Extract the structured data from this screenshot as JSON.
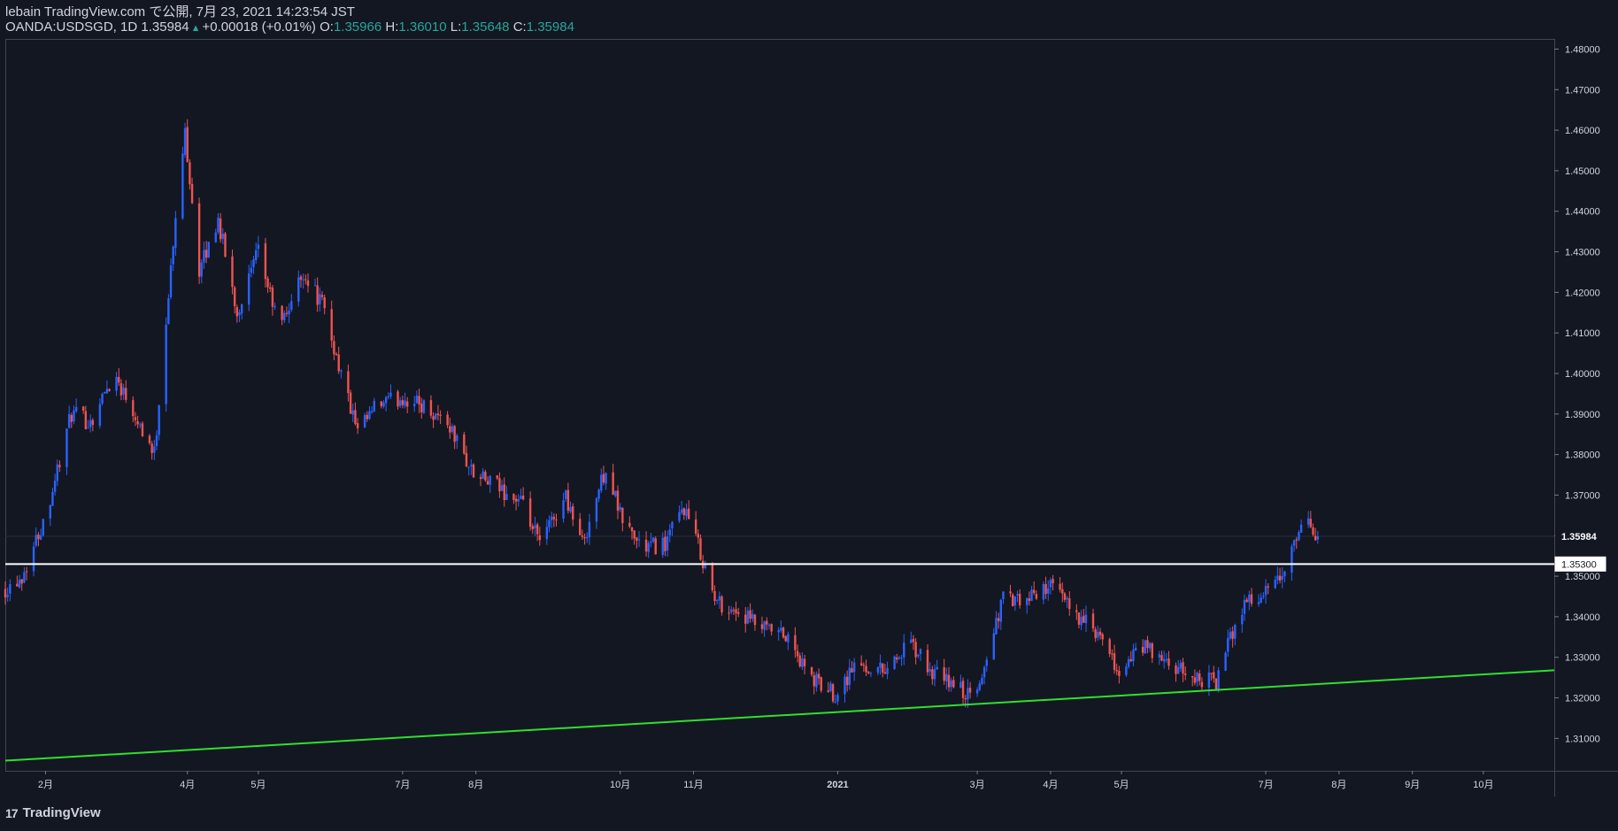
{
  "header": {
    "line1": "lebain TradingView.com で公開, 7月 23, 2021 14:23:54 JST",
    "symbol": "OANDA:USDSGD, 1D",
    "last": "1.35984",
    "change": "+0.00018 (+0.01%)",
    "o_label": "O:",
    "o_value": "1.35966",
    "h_label": "H:",
    "h_value": "1.36010",
    "l_label": "L:",
    "l_value": "1.35648",
    "c_label": "C:",
    "c_value": "1.35984"
  },
  "footer": {
    "brand": "TradingView",
    "logo_mark": "17"
  },
  "colors": {
    "up": "#2962ff",
    "down": "#ef5350",
    "support": "#2fe02f",
    "level": "#ffffff",
    "bg": "#131722",
    "border": "#434651"
  },
  "chart_data": {
    "type": "candlestick",
    "price_axis": {
      "ticks": [
        1.31,
        1.32,
        1.33,
        1.34,
        1.35,
        1.36,
        1.37,
        1.38,
        1.39,
        1.4,
        1.41,
        1.42,
        1.43,
        1.44,
        1.45,
        1.46,
        1.47,
        1.48
      ],
      "tick_labels": [
        "1.31000",
        "1.32000",
        "1.33000",
        "1.34000",
        "1.35000",
        "1.36000",
        "1.37000",
        "1.38000",
        "1.39000",
        "1.40000",
        "1.41000",
        "1.42000",
        "1.43000",
        "1.44000",
        "1.45000",
        "1.46000",
        "1.47000",
        "1.48000"
      ],
      "range": [
        1.302,
        1.4825
      ]
    },
    "time_axis": {
      "range": [
        "2020-01-15",
        "2021-10-31"
      ],
      "ticks": [
        {
          "date": "2020-02-01",
          "label": "2月"
        },
        {
          "date": "2020-04-01",
          "label": "4月"
        },
        {
          "date": "2020-05-01",
          "label": "5月"
        },
        {
          "date": "2020-07-01",
          "label": "7月"
        },
        {
          "date": "2020-08-01",
          "label": "8月"
        },
        {
          "date": "2020-10-01",
          "label": "10月"
        },
        {
          "date": "2020-11-01",
          "label": "11月"
        },
        {
          "date": "2021-01-01",
          "label": "2021"
        },
        {
          "date": "2021-03-01",
          "label": "3月"
        },
        {
          "date": "2021-04-01",
          "label": "4月"
        },
        {
          "date": "2021-05-01",
          "label": "5月"
        },
        {
          "date": "2021-07-01",
          "label": "7月"
        },
        {
          "date": "2021-08-01",
          "label": "8月"
        },
        {
          "date": "2021-09-01",
          "label": "9月"
        },
        {
          "date": "2021-10-01",
          "label": "10月"
        }
      ]
    },
    "close_path": [
      [
        "2020-01-15",
        1.347
      ],
      [
        "2020-01-22",
        1.35
      ],
      [
        "2020-02-01",
        1.365
      ],
      [
        "2020-02-12",
        1.39
      ],
      [
        "2020-02-20",
        1.388
      ],
      [
        "2020-03-01",
        1.4
      ],
      [
        "2020-03-10",
        1.39
      ],
      [
        "2020-03-18",
        1.38
      ],
      [
        "2020-03-24",
        1.42
      ],
      [
        "2020-03-31",
        1.46
      ],
      [
        "2020-04-06",
        1.425
      ],
      [
        "2020-04-14",
        1.438
      ],
      [
        "2020-04-22",
        1.415
      ],
      [
        "2020-05-01",
        1.43
      ],
      [
        "2020-05-10",
        1.411
      ],
      [
        "2020-05-20",
        1.425
      ],
      [
        "2020-05-28",
        1.417
      ],
      [
        "2020-06-05",
        1.4
      ],
      [
        "2020-06-12",
        1.385
      ],
      [
        "2020-06-20",
        1.392
      ],
      [
        "2020-07-01",
        1.394
      ],
      [
        "2020-07-10",
        1.392
      ],
      [
        "2020-07-20",
        1.388
      ],
      [
        "2020-07-31",
        1.375
      ],
      [
        "2020-08-10",
        1.372
      ],
      [
        "2020-08-20",
        1.368
      ],
      [
        "2020-08-28",
        1.358
      ],
      [
        "2020-09-08",
        1.37
      ],
      [
        "2020-09-15",
        1.358
      ],
      [
        "2020-09-25",
        1.377
      ],
      [
        "2020-10-01",
        1.365
      ],
      [
        "2020-10-10",
        1.357
      ],
      [
        "2020-10-20",
        1.358
      ],
      [
        "2020-10-28",
        1.367
      ],
      [
        "2020-11-04",
        1.356
      ],
      [
        "2020-11-10",
        1.344
      ],
      [
        "2020-11-20",
        1.341
      ],
      [
        "2020-11-30",
        1.337
      ],
      [
        "2020-12-10",
        1.335
      ],
      [
        "2020-12-20",
        1.325
      ],
      [
        "2020-12-31",
        1.321
      ],
      [
        "2021-01-08",
        1.328
      ],
      [
        "2021-01-20",
        1.327
      ],
      [
        "2021-02-01",
        1.333
      ],
      [
        "2021-02-10",
        1.326
      ],
      [
        "2021-02-20",
        1.323
      ],
      [
        "2021-02-28",
        1.319
      ],
      [
        "2021-03-05",
        1.33
      ],
      [
        "2021-03-12",
        1.345
      ],
      [
        "2021-03-20",
        1.343
      ],
      [
        "2021-03-31",
        1.348
      ],
      [
        "2021-04-10",
        1.342
      ],
      [
        "2021-04-20",
        1.336
      ],
      [
        "2021-04-30",
        1.326
      ],
      [
        "2021-05-10",
        1.333
      ],
      [
        "2021-05-20",
        1.328
      ],
      [
        "2021-05-31",
        1.325
      ],
      [
        "2021-06-10",
        1.324
      ],
      [
        "2021-06-15",
        1.333
      ],
      [
        "2021-06-22",
        1.344
      ],
      [
        "2021-06-30",
        1.345
      ],
      [
        "2021-07-08",
        1.35
      ],
      [
        "2021-07-15",
        1.36
      ],
      [
        "2021-07-19",
        1.363
      ],
      [
        "2021-07-23",
        1.3598
      ]
    ],
    "lines": [
      {
        "name": "support",
        "from": [
          "2020-01-15",
          1.3045
        ],
        "to": [
          "2021-10-31",
          1.3268
        ]
      },
      {
        "name": "level",
        "price": 1.353
      }
    ],
    "price_labels": [
      {
        "price": 1.35984,
        "text": "1.35984",
        "style": "last"
      },
      {
        "price": 1.353,
        "text": "1.35300",
        "style": "level"
      }
    ]
  }
}
